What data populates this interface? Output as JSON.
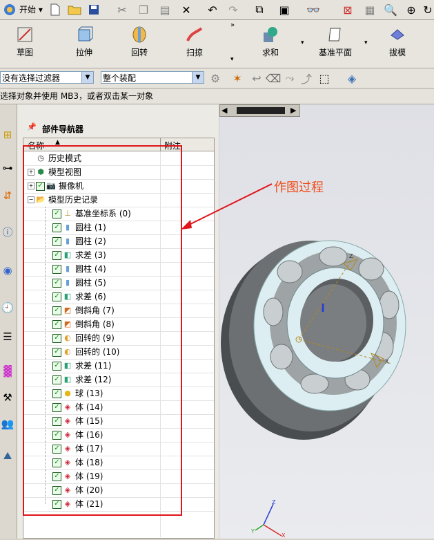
{
  "toolbar_top": {
    "start_label": "开始",
    "icons": [
      "app-logo-icon",
      "new-file-icon",
      "open-folder-icon",
      "save-icon",
      "cut-icon",
      "copy-icon",
      "paste-icon",
      "delete-icon",
      "undo-icon",
      "redo-icon",
      "ops-icon",
      "display-icon",
      "binoculars-icon",
      "fit-icon",
      "zoom-window-icon",
      "zoom-icon",
      "rotate-icon"
    ]
  },
  "feature_toolbar": {
    "buttons": [
      {
        "label": "草图",
        "icon": "sketch-icon"
      },
      {
        "label": "拉伸",
        "icon": "extrude-icon"
      },
      {
        "label": "回转",
        "icon": "revolve-icon"
      },
      {
        "label": "扫掠",
        "icon": "sweep-icon"
      },
      {
        "label": "求和",
        "icon": "unite-icon"
      },
      {
        "label": "基准平面",
        "icon": "datum-plane-icon"
      },
      {
        "label": "拔模",
        "icon": "draft-icon"
      }
    ]
  },
  "selection_bar": {
    "filter_value": "没有选择过滤器",
    "scope_value": "整个装配"
  },
  "cue_line": "选择对象并使用 MB3，或者双击某一对象",
  "navigator": {
    "title": "部件导航器",
    "col_name": "名称",
    "col_note": "附注",
    "top_nodes": [
      {
        "label": "历史模式",
        "icon": "clock-icon"
      },
      {
        "label": "模型视图",
        "icon": "model-views-icon"
      },
      {
        "label": "摄像机",
        "icon": "camera-icon"
      },
      {
        "label": "模型历史记录",
        "icon": "folder-open-icon"
      }
    ],
    "features": [
      {
        "label": "基准坐标系 (0)",
        "icon": "datum-csys-icon"
      },
      {
        "label": "圆柱 (1)",
        "icon": "cylinder-icon"
      },
      {
        "label": "圆柱 (2)",
        "icon": "cylinder-icon"
      },
      {
        "label": "求差 (3)",
        "icon": "subtract-icon"
      },
      {
        "label": "圆柱 (4)",
        "icon": "cylinder-icon"
      },
      {
        "label": "圆柱 (5)",
        "icon": "cylinder-icon"
      },
      {
        "label": "求差 (6)",
        "icon": "subtract-icon"
      },
      {
        "label": "倒斜角 (7)",
        "icon": "chamfer-icon"
      },
      {
        "label": "倒斜角 (8)",
        "icon": "chamfer-icon"
      },
      {
        "label": "回转的 (9)",
        "icon": "revolved-icon"
      },
      {
        "label": "回转的 (10)",
        "icon": "revolved-icon"
      },
      {
        "label": "求差 (11)",
        "icon": "subtract-icon"
      },
      {
        "label": "求差 (12)",
        "icon": "subtract-icon"
      },
      {
        "label": "球 (13)",
        "icon": "sphere-icon"
      },
      {
        "label": "体 (14)",
        "icon": "body-icon"
      },
      {
        "label": "体 (15)",
        "icon": "body-icon"
      },
      {
        "label": "体 (16)",
        "icon": "body-icon"
      },
      {
        "label": "体 (17)",
        "icon": "body-icon"
      },
      {
        "label": "体 (18)",
        "icon": "body-icon"
      },
      {
        "label": "体 (19)",
        "icon": "body-icon"
      },
      {
        "label": "体 (20)",
        "icon": "body-icon"
      },
      {
        "label": "体 (21)",
        "icon": "body-icon"
      }
    ]
  },
  "annotation": "作图过程",
  "colors": {
    "highlight_red": "#e0141a",
    "annotation_orange": "#f04a16",
    "check_green": "#138a13"
  }
}
